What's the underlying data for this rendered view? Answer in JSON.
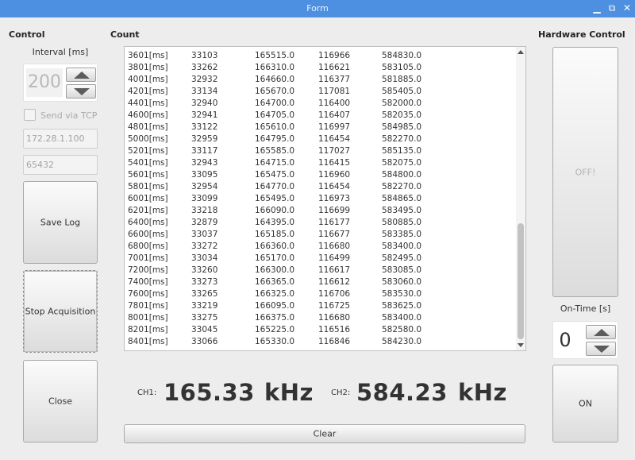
{
  "window": {
    "title": "Form",
    "minimize_glyph": "▁",
    "maximize_glyph": "⧉",
    "close_glyph": "✕"
  },
  "control": {
    "section_label": "Control",
    "interval_label": "Interval [ms]",
    "interval_value": "200",
    "send_via_tcp_label": "Send via TCP",
    "send_via_tcp_checked": false,
    "ip_value": "172.28.1.100",
    "port_value": "65432",
    "save_log_label": "Save Log",
    "stop_acquisition_label": "Stop Acquisition",
    "close_label": "Close"
  },
  "count": {
    "section_label": "Count",
    "rows": [
      [
        "3601[ms]",
        "33103",
        "165515.0",
        "116966",
        "584830.0"
      ],
      [
        "3801[ms]",
        "33262",
        "166310.0",
        "116621",
        "583105.0"
      ],
      [
        "4001[ms]",
        "32932",
        "164660.0",
        "116377",
        "581885.0"
      ],
      [
        "4201[ms]",
        "33134",
        "165670.0",
        "117081",
        "585405.0"
      ],
      [
        "4401[ms]",
        "32940",
        "164700.0",
        "116400",
        "582000.0"
      ],
      [
        "4600[ms]",
        "32941",
        "164705.0",
        "116407",
        "582035.0"
      ],
      [
        "4801[ms]",
        "33122",
        "165610.0",
        "116997",
        "584985.0"
      ],
      [
        "5000[ms]",
        "32959",
        "164795.0",
        "116454",
        "582270.0"
      ],
      [
        "5201[ms]",
        "33117",
        "165585.0",
        "117027",
        "585135.0"
      ],
      [
        "5401[ms]",
        "32943",
        "164715.0",
        "116415",
        "582075.0"
      ],
      [
        "5601[ms]",
        "33095",
        "165475.0",
        "116960",
        "584800.0"
      ],
      [
        "5801[ms]",
        "32954",
        "164770.0",
        "116454",
        "582270.0"
      ],
      [
        "6001[ms]",
        "33099",
        "165495.0",
        "116973",
        "584865.0"
      ],
      [
        "6201[ms]",
        "33218",
        "166090.0",
        "116699",
        "583495.0"
      ],
      [
        "6400[ms]",
        "32879",
        "164395.0",
        "116177",
        "580885.0"
      ],
      [
        "6600[ms]",
        "33037",
        "165185.0",
        "116677",
        "583385.0"
      ],
      [
        "6800[ms]",
        "33272",
        "166360.0",
        "116680",
        "583400.0"
      ],
      [
        "7001[ms]",
        "33034",
        "165170.0",
        "116499",
        "582495.0"
      ],
      [
        "7200[ms]",
        "33260",
        "166300.0",
        "116617",
        "583085.0"
      ],
      [
        "7400[ms]",
        "33273",
        "166365.0",
        "116612",
        "583060.0"
      ],
      [
        "7600[ms]",
        "33265",
        "166325.0",
        "116706",
        "583530.0"
      ],
      [
        "7801[ms]",
        "33219",
        "166095.0",
        "116725",
        "583625.0"
      ],
      [
        "8001[ms]",
        "33275",
        "166375.0",
        "116680",
        "583400.0"
      ],
      [
        "8201[ms]",
        "33045",
        "165225.0",
        "116516",
        "582580.0"
      ],
      [
        "8401[ms]",
        "33066",
        "165330.0",
        "116846",
        "584230.0"
      ]
    ],
    "ch1_label": "CH1:",
    "ch1_value": "165.33",
    "ch1_unit": "kHz",
    "ch2_label": "CH2:",
    "ch2_value": "584.23",
    "ch2_unit": "kHz",
    "clear_label": "Clear"
  },
  "hardware": {
    "section_label": "Hardware Control",
    "off_label": "OFF!",
    "ontime_label": "On-Time [s]",
    "ontime_value": "0",
    "on_label": "ON"
  },
  "colors": {
    "titlebar": "#4d8fe0",
    "window_bg": "#ededed"
  }
}
